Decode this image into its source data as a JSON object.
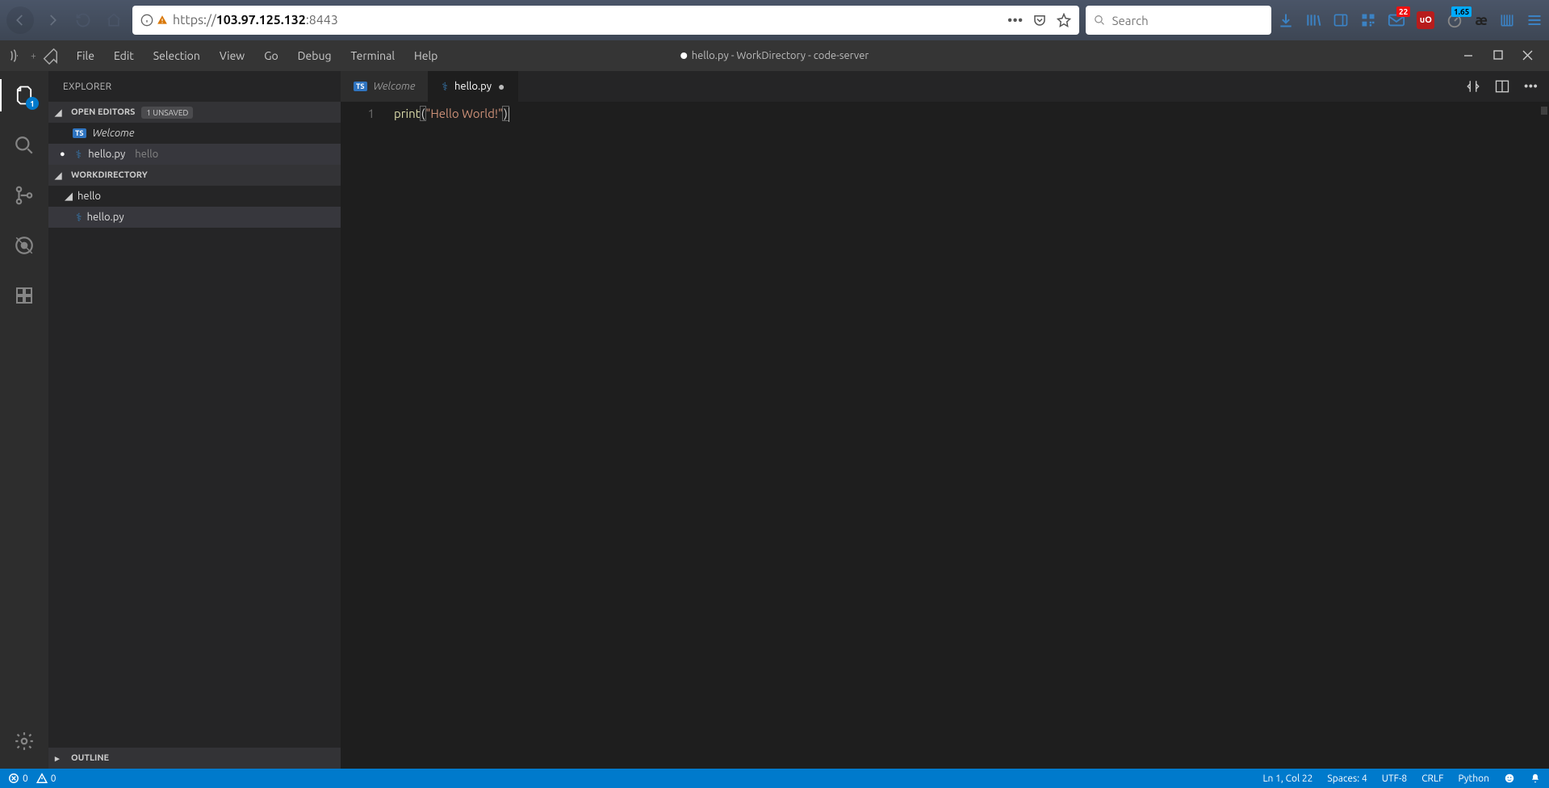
{
  "browser": {
    "url_host": "103.97.125.132",
    "url_prefix": "https://",
    "url_port": ":8443",
    "search_placeholder": "Search",
    "mail_badge": "22",
    "meter_badge": "1.65",
    "ublock_label": "uO"
  },
  "menubar": {
    "items": [
      "File",
      "Edit",
      "Selection",
      "View",
      "Go",
      "Debug",
      "Terminal",
      "Help"
    ],
    "window_title": "hello.py - WorkDirectory - code-server"
  },
  "activity": {
    "explorer_badge": "1"
  },
  "sidebar": {
    "title": "EXPLORER",
    "open_editors_label": "OPEN EDITORS",
    "unsaved_tag": "1 UNSAVED",
    "open_editors": [
      {
        "name": "Welcome",
        "lang": "TS",
        "italic": true,
        "dirty": false
      },
      {
        "name": "hello.py",
        "lang": "py",
        "hint": "hello",
        "dirty": true
      }
    ],
    "workspace_label": "WORKDIRECTORY",
    "folder": "hello",
    "file": "hello.py",
    "outline_label": "OUTLINE"
  },
  "tabs": {
    "welcome": "Welcome",
    "hello": "hello.py"
  },
  "editor": {
    "line_no": "1",
    "tok_print": "print",
    "tok_open": "(",
    "tok_string": "\"Hello World!\"",
    "tok_close": ")"
  },
  "status": {
    "errors": "0",
    "warnings": "0",
    "cursor": "Ln 1, Col 22",
    "spaces": "Spaces: 4",
    "encoding": "UTF-8",
    "eol": "CRLF",
    "lang": "Python"
  }
}
